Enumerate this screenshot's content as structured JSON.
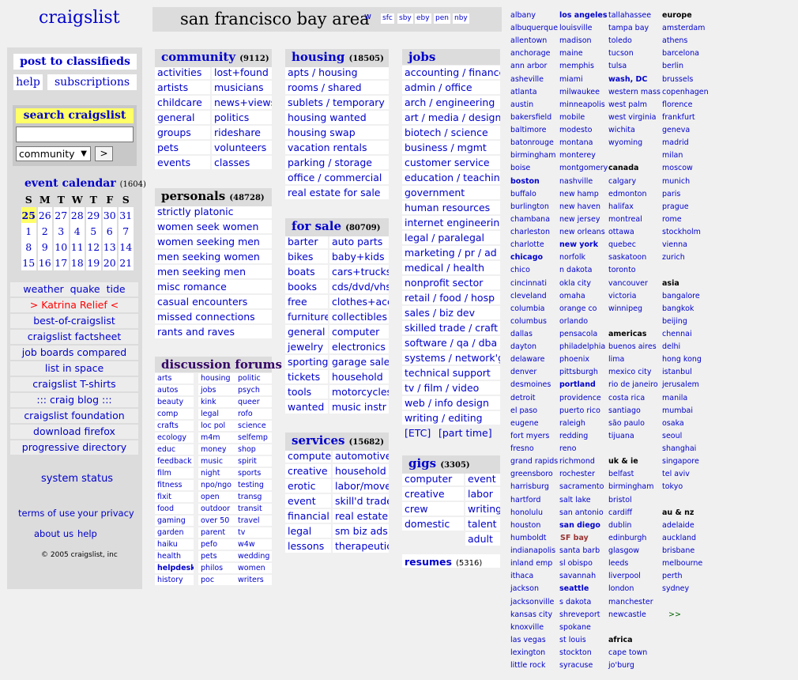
{
  "logo": "craigslist",
  "left": {
    "post": "post to classifieds",
    "help": "help",
    "subscriptions": "subscriptions",
    "search_title": "search craigslist",
    "search_select": "community",
    "go": ">",
    "event_title": "event calendar",
    "event_count": "(1604)",
    "cal_head": [
      "S",
      "M",
      "T",
      "W",
      "T",
      "F",
      "S"
    ],
    "cal_rows": [
      [
        "25",
        "26",
        "27",
        "28",
        "29",
        "30",
        "31"
      ],
      [
        "1",
        "2",
        "3",
        "4",
        "5",
        "6",
        "7"
      ],
      [
        "8",
        "9",
        "10",
        "11",
        "12",
        "13",
        "14"
      ],
      [
        "15",
        "16",
        "17",
        "18",
        "19",
        "20",
        "21"
      ]
    ],
    "weather": "weather",
    "quake": "quake",
    "tide": "tide",
    "katrina": "> Katrina Relief <",
    "links": [
      "best-of-craigslist",
      "craigslist factsheet",
      "job boards compared",
      "list in space",
      "craigslist T-shirts",
      "::: craig blog :::",
      "craigslist foundation",
      "download firefox",
      "progressive directory"
    ],
    "system": "system status",
    "terms": "terms of use",
    "privacy": "your privacy",
    "about": "about us",
    "help2": "help",
    "copyright": "© 2005 craigslist, inc"
  },
  "top": {
    "title": "san francisco bay area",
    "w": "w",
    "subs": [
      "sfc",
      "sby",
      "eby",
      "pen",
      "nby"
    ]
  },
  "community": {
    "title": "community",
    "count": "(9112)",
    "col1": [
      "activities",
      "artists",
      "childcare",
      "general",
      "groups",
      "pets",
      "events"
    ],
    "col2": [
      "lost+found",
      "musicians",
      "news+views",
      "politics",
      "rideshare",
      "volunteers",
      "classes"
    ]
  },
  "personals": {
    "title": "personals",
    "count": "(48728)",
    "items": [
      "strictly platonic",
      "women seek women",
      "women seeking men",
      "men seeking women",
      "men seeking men",
      "misc romance",
      "casual encounters",
      "missed connections",
      "rants and raves"
    ]
  },
  "forums": {
    "title": "discussion forums",
    "col1": [
      "arts",
      "autos",
      "beauty",
      "comp",
      "crafts",
      "ecology",
      "educ",
      "feedback",
      "film",
      "fitness",
      "fixit",
      "food",
      "gaming",
      "garden",
      "haiku",
      "health",
      "helpdesk",
      "history"
    ],
    "col2": [
      "housing",
      "jobs",
      "kink",
      "legal",
      "loc pol",
      "m4m",
      "money",
      "music",
      "night",
      "npo/ngo",
      "open",
      "outdoor",
      "over 50",
      "parent",
      "pefo",
      "pets",
      "philos",
      "poc"
    ],
    "col3": [
      "politic",
      "psych",
      "queer",
      "rofo",
      "science",
      "selfemp",
      "shop",
      "spirit",
      "sports",
      "testing",
      "transg",
      "transit",
      "travel",
      "tv",
      "w4w",
      "wedding",
      "women",
      "writers"
    ]
  },
  "housing": {
    "title": "housing",
    "count": "(18505)",
    "items": [
      "apts / housing",
      "rooms / shared",
      "sublets / temporary",
      "housing wanted",
      "housing swap",
      "vacation rentals",
      "parking / storage",
      "office / commercial",
      "real estate for sale"
    ]
  },
  "forsale": {
    "title": "for sale",
    "count": "(80709)",
    "col1": [
      "barter",
      "bikes",
      "boats",
      "books",
      "free",
      "furniture",
      "general",
      "jewelry",
      "sporting",
      "tickets",
      "tools",
      "wanted"
    ],
    "col2": [
      "auto parts",
      "baby+kids",
      "cars+trucks",
      "cds/dvd/vhs",
      "clothes+acc",
      "collectibles",
      "computer",
      "electronics",
      "garage sale",
      "household",
      "motorcycles",
      "music instr"
    ]
  },
  "services": {
    "title": "services",
    "count": "(15682)",
    "col1": [
      "computer",
      "creative",
      "erotic",
      "event",
      "financial",
      "legal",
      "lessons"
    ],
    "col2": [
      "automotive",
      "household",
      "labor/move",
      "skill'd trade",
      "real estate",
      "sm biz ads",
      "therapeutic"
    ]
  },
  "jobs": {
    "title": "jobs",
    "items": [
      "accounting / finance",
      "admin / office",
      "arch / engineering",
      "art / media / design",
      "biotech / science",
      "business / mgmt",
      "customer service",
      "education / teaching",
      "government",
      "human resources",
      "internet engineering",
      "legal / paralegal",
      "marketing / pr / ad",
      "medical / health",
      "nonprofit sector",
      "retail / food / hosp",
      "sales / biz dev",
      "skilled trade / craft",
      "software / qa / dba",
      "systems / network'g",
      "technical support",
      "tv / film / video",
      "web / info design",
      "writing / editing"
    ],
    "etc": "[ETC]",
    "parttime": "[part time]"
  },
  "gigs": {
    "title": "gigs",
    "count": "(3305)",
    "col1": [
      "computer",
      "creative",
      "crew",
      "domestic"
    ],
    "col2": [
      "event",
      "labor",
      "writing",
      "talent",
      "adult"
    ]
  },
  "resumes": {
    "title": "resumes",
    "count": "(5316)"
  },
  "cities": {
    "c1": [
      "albany",
      "albuquerque",
      "allentown",
      "anchorage",
      "ann arbor",
      "asheville",
      "atlanta",
      "austin",
      "bakersfield",
      "baltimore",
      "batonrouge",
      "birmingham",
      "boise",
      "boston",
      "buffalo",
      "burlington",
      "chambana",
      "charleston",
      "charlotte",
      "chicago",
      "chico",
      "cincinnati",
      "cleveland",
      "columbia",
      "columbus",
      "dallas",
      "dayton",
      "delaware",
      "denver",
      "desmoines",
      "detroit",
      "el paso",
      "eugene",
      "fort myers",
      "fresno",
      "grand rapids",
      "greensboro",
      "harrisburg",
      "hartford",
      "honolulu",
      "houston",
      "humboldt",
      "indianapolis",
      "inland emp",
      "ithaca",
      "jackson",
      "jacksonville",
      "kansas city",
      "knoxville",
      "las vegas",
      "lexington",
      "little rock"
    ],
    "c2": [
      "los angeles",
      "louisville",
      "madison",
      "maine",
      "memphis",
      "miami",
      "milwaukee",
      "minneapolis",
      "mobile",
      "modesto",
      "montana",
      "monterey",
      "montgomery",
      "nashville",
      "new hamp",
      "new haven",
      "new jersey",
      "new orleans",
      "new york",
      "norfolk",
      "n dakota",
      "okla city",
      "omaha",
      "orange co",
      "orlando",
      "pensacola",
      "philadelphia",
      "phoenix",
      "pittsburgh",
      "portland",
      "providence",
      "puerto rico",
      "raleigh",
      "redding",
      "reno",
      "richmond",
      "rochester",
      "sacramento",
      "salt lake",
      "san antonio",
      "san diego",
      "SF bay",
      "santa barb",
      "sl obispo",
      "savannah",
      "seattle",
      "s dakota",
      "shreveport",
      "spokane",
      "st louis",
      "stockton",
      "syracuse"
    ],
    "c3": [
      "tallahassee",
      "tampa bay",
      "toledo",
      "tucson",
      "tulsa",
      "wash, DC",
      "western mass",
      "west palm",
      "west virginia",
      "wichita",
      "wyoming",
      "",
      "canada",
      "calgary",
      "edmonton",
      "halifax",
      "montreal",
      "ottawa",
      "quebec",
      "saskatoon",
      "toronto",
      "vancouver",
      "victoria",
      "winnipeg",
      "",
      "americas",
      "buenos aires",
      "lima",
      "mexico city",
      "rio de janeiro",
      "costa rica",
      "santiago",
      "são paulo",
      "tijuana",
      "",
      "uk & ie",
      "belfast",
      "birmingham",
      "bristol",
      "cardiff",
      "dublin",
      "edinburgh",
      "glasgow",
      "leeds",
      "liverpool",
      "london",
      "manchester",
      "newcastle",
      "",
      "africa",
      "cape town",
      "jo'burg"
    ],
    "c4": [
      "europe",
      "amsterdam",
      "athens",
      "barcelona",
      "berlin",
      "brussels",
      "copenhagen",
      "florence",
      "frankfurt",
      "geneva",
      "madrid",
      "milan",
      "moscow",
      "munich",
      "paris",
      "prague",
      "rome",
      "stockholm",
      "vienna",
      "zurich",
      "",
      "asia",
      "bangalore",
      "bangkok",
      "beijing",
      "chennai",
      "delhi",
      "hong kong",
      "istanbul",
      "jerusalem",
      "manila",
      "mumbai",
      "osaka",
      "seoul",
      "shanghai",
      "singapore",
      "tel aviv",
      "tokyo",
      "",
      "au & nz",
      "adelaide",
      "auckland",
      "brisbane",
      "melbourne",
      "perth",
      "sydney",
      "",
      ">>"
    ]
  },
  "colors": {
    "accent": "#0000cc",
    "highlight": "#ffff66",
    "alert": "#ff0000",
    "sfbay": "#993333",
    "gray": "#dcdcdc"
  }
}
